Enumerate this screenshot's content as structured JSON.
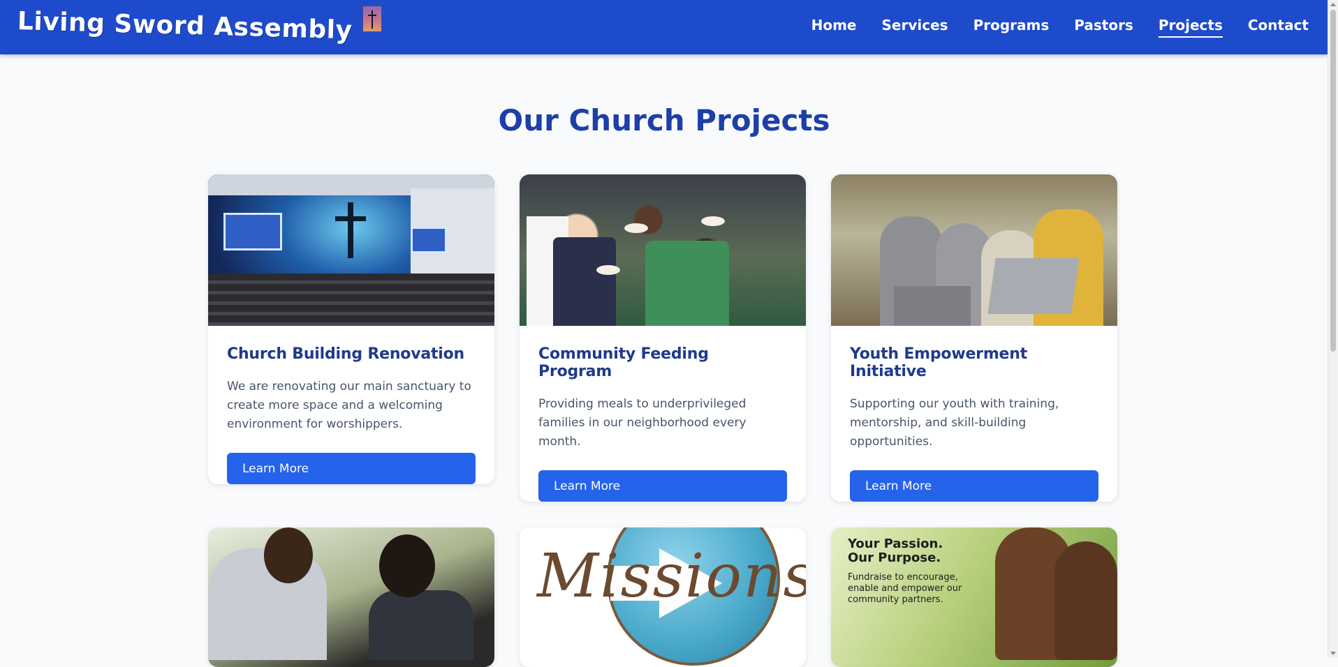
{
  "site": {
    "brand": "Living Sword Assembly",
    "logo_icon": "cross-logo-icon"
  },
  "nav": {
    "items": [
      {
        "label": "Home",
        "active": false
      },
      {
        "label": "Services",
        "active": false
      },
      {
        "label": "Programs",
        "active": false
      },
      {
        "label": "Pastors",
        "active": false
      },
      {
        "label": "Projects",
        "active": true
      },
      {
        "label": "Contact",
        "active": false
      }
    ]
  },
  "page": {
    "title": "Our Church Projects"
  },
  "projects": [
    {
      "title": "Church Building Renovation",
      "description": "We are renovating our main sanctuary to create more space and a welcoming environment for worshippers.",
      "button": "Learn More",
      "image": "church-interior-image"
    },
    {
      "title": "Community Feeding Program",
      "description": "Providing meals to underprivileged families in our neighborhood every month.",
      "button": "Learn More",
      "image": "community-feeding-image"
    },
    {
      "title": "Youth Empowerment Initiative",
      "description": "Supporting our youth with training, mentorship, and skill-building opportunities.",
      "button": "Learn More",
      "image": "youth-laptops-image"
    },
    {
      "image": "medical-checkup-image"
    },
    {
      "image": "missions-globe-image",
      "image_text": "Missions"
    },
    {
      "image": "fundraise-children-image",
      "image_headline_1": "Your Passion.",
      "image_headline_2": "Our Purpose.",
      "image_subtext": "Fundraise to encourage, enable and empower our community partners."
    }
  ],
  "colors": {
    "header": "#1e4bcc",
    "title": "#1e3fa8",
    "card_title": "#1e3a8a",
    "button": "#2563eb",
    "background": "#f8fafc"
  }
}
